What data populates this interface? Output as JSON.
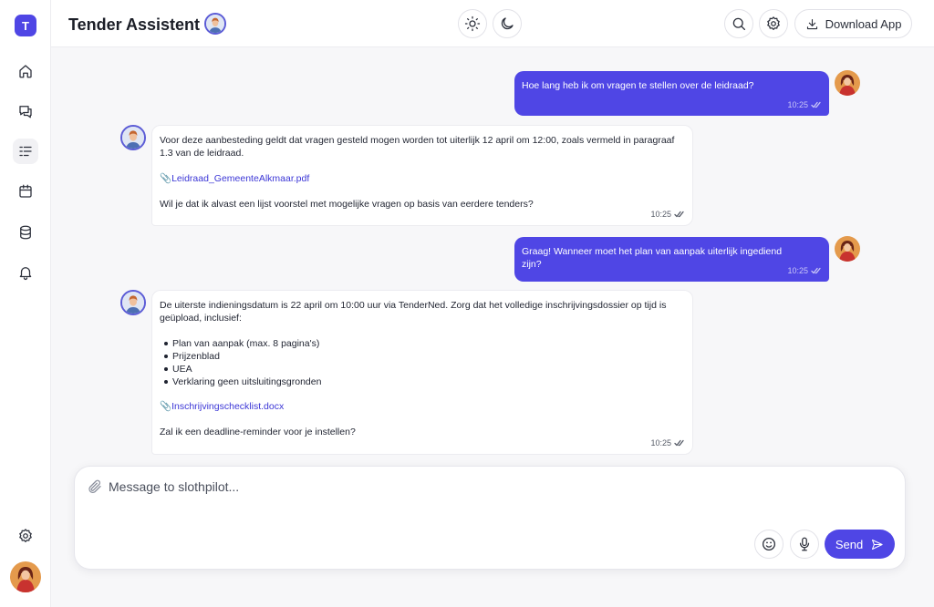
{
  "app": {
    "logo_letter": "T",
    "title": "Tender Assistent",
    "accent_color": "#4f46e5"
  },
  "sidebar": {
    "items": [
      {
        "icon": "home-icon"
      },
      {
        "icon": "chat-icon"
      },
      {
        "icon": "list-icon"
      },
      {
        "icon": "calendar-icon"
      },
      {
        "icon": "database-icon"
      },
      {
        "icon": "bell-icon"
      }
    ],
    "bottom": [
      {
        "icon": "gear-icon"
      },
      {
        "icon": "user-avatar"
      }
    ]
  },
  "header": {
    "theme_light_icon": "sun-icon",
    "theme_dark_icon": "moon-icon",
    "search_icon": "search-icon",
    "settings_icon": "gear-icon",
    "download_label": "Download App"
  },
  "messages": [
    {
      "role": "user",
      "text": "Hoe lang heb ik om vragen te stellen over  de leidraad?",
      "time": "10:25"
    },
    {
      "role": "assistant",
      "text": "Voor deze aanbesteding geldt dat vragen gesteld mogen worden tot uiterlijk 12 april om 12:00, zoals vermeld in paragraaf 1.3 van de leidraad.",
      "attachment": "Leidraad_GemeenteAlkmaar.pdf",
      "followup": "Wil je dat ik alvast een lijst voorstel met mogelijke vragen op basis van eerdere tenders?",
      "time": "10:25"
    },
    {
      "role": "user",
      "text": "Graag! Wanneer moet het plan van aanpak uiterlijk ingediend zijn?",
      "time": "10:25"
    },
    {
      "role": "assistant",
      "text": "De uiterste indieningsdatum is 22 april om 10:00 uur via TenderNed. Zorg dat het volledige inschrijvingsdossier op tijd is geüpload, inclusief:",
      "bullets": [
        "Plan van aanpak (max. 8 pagina's)",
        "Prijzenblad",
        "UEA",
        "Verklaring geen uitsluitingsgronden"
      ],
      "attachment": "Inschrijvingschecklist.docx",
      "followup": "Zal ik een deadline-reminder voor je instellen?",
      "time": "10:25"
    }
  ],
  "composer": {
    "placeholder": "Message to slothpilot...",
    "send_label": "Send"
  }
}
